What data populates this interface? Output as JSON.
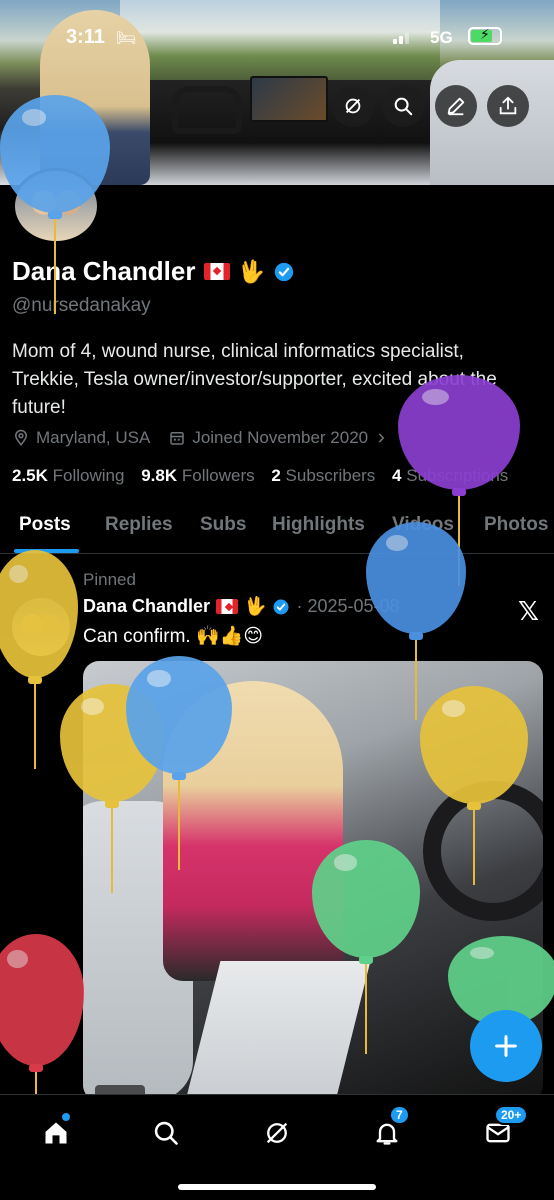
{
  "status_bar": {
    "time": "3:11",
    "network": "5G"
  },
  "header_actions": [
    {
      "name": "grok-icon"
    },
    {
      "name": "search-icon"
    },
    {
      "name": "edit-icon"
    },
    {
      "name": "share-icon"
    }
  ],
  "profile": {
    "name": "Dana Chandler",
    "emoji_hand": "🖖",
    "handle": "@nursedanakay",
    "bio": "Mom of 4, wound nurse, clinical informatics specialist, Trekkie, Tesla owner/investor/supporter, excited about the future!",
    "location": "Maryland, USA",
    "joined": "Joined November 2020",
    "stats": {
      "following_count": "2.5K",
      "following_label": "Following",
      "followers_count": "9.8K",
      "followers_label": "Followers",
      "subscribers_count": "2",
      "subscribers_label": "Subscribers",
      "subscriptions_count": "4",
      "subscriptions_label": "Subscriptions"
    }
  },
  "tabs": [
    "Posts",
    "Replies",
    "Subs",
    "Highlights",
    "Videos",
    "Photos"
  ],
  "post": {
    "pinned_label": "Pinned",
    "author": "Dana Chandler",
    "date": "2025-05-08",
    "text": "Can confirm. 🙌👍😊"
  },
  "bottom_nav": {
    "notifications_badge": "7",
    "messages_badge": "20+"
  },
  "colors": {
    "accent": "#1d9bf0",
    "background": "#000000",
    "muted": "#71767b"
  }
}
